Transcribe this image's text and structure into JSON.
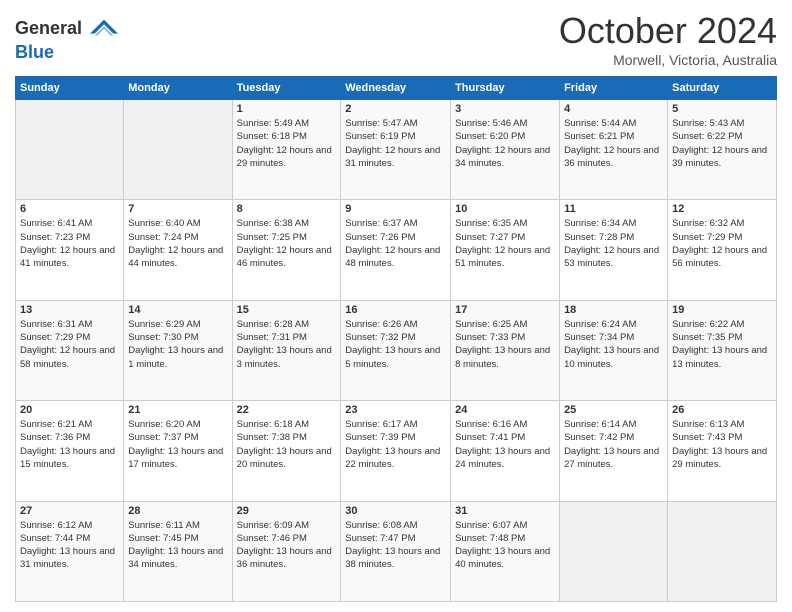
{
  "logo": {
    "line1": "General",
    "line2": "Blue"
  },
  "title": "October 2024",
  "location": "Morwell, Victoria, Australia",
  "days_of_week": [
    "Sunday",
    "Monday",
    "Tuesday",
    "Wednesday",
    "Thursday",
    "Friday",
    "Saturday"
  ],
  "weeks": [
    [
      {
        "day": "",
        "sunrise": "",
        "sunset": "",
        "daylight": ""
      },
      {
        "day": "",
        "sunrise": "",
        "sunset": "",
        "daylight": ""
      },
      {
        "day": "1",
        "sunrise": "Sunrise: 5:49 AM",
        "sunset": "Sunset: 6:18 PM",
        "daylight": "Daylight: 12 hours and 29 minutes."
      },
      {
        "day": "2",
        "sunrise": "Sunrise: 5:47 AM",
        "sunset": "Sunset: 6:19 PM",
        "daylight": "Daylight: 12 hours and 31 minutes."
      },
      {
        "day": "3",
        "sunrise": "Sunrise: 5:46 AM",
        "sunset": "Sunset: 6:20 PM",
        "daylight": "Daylight: 12 hours and 34 minutes."
      },
      {
        "day": "4",
        "sunrise": "Sunrise: 5:44 AM",
        "sunset": "Sunset: 6:21 PM",
        "daylight": "Daylight: 12 hours and 36 minutes."
      },
      {
        "day": "5",
        "sunrise": "Sunrise: 5:43 AM",
        "sunset": "Sunset: 6:22 PM",
        "daylight": "Daylight: 12 hours and 39 minutes."
      }
    ],
    [
      {
        "day": "6",
        "sunrise": "Sunrise: 6:41 AM",
        "sunset": "Sunset: 7:23 PM",
        "daylight": "Daylight: 12 hours and 41 minutes."
      },
      {
        "day": "7",
        "sunrise": "Sunrise: 6:40 AM",
        "sunset": "Sunset: 7:24 PM",
        "daylight": "Daylight: 12 hours and 44 minutes."
      },
      {
        "day": "8",
        "sunrise": "Sunrise: 6:38 AM",
        "sunset": "Sunset: 7:25 PM",
        "daylight": "Daylight: 12 hours and 46 minutes."
      },
      {
        "day": "9",
        "sunrise": "Sunrise: 6:37 AM",
        "sunset": "Sunset: 7:26 PM",
        "daylight": "Daylight: 12 hours and 48 minutes."
      },
      {
        "day": "10",
        "sunrise": "Sunrise: 6:35 AM",
        "sunset": "Sunset: 7:27 PM",
        "daylight": "Daylight: 12 hours and 51 minutes."
      },
      {
        "day": "11",
        "sunrise": "Sunrise: 6:34 AM",
        "sunset": "Sunset: 7:28 PM",
        "daylight": "Daylight: 12 hours and 53 minutes."
      },
      {
        "day": "12",
        "sunrise": "Sunrise: 6:32 AM",
        "sunset": "Sunset: 7:29 PM",
        "daylight": "Daylight: 12 hours and 56 minutes."
      }
    ],
    [
      {
        "day": "13",
        "sunrise": "Sunrise: 6:31 AM",
        "sunset": "Sunset: 7:29 PM",
        "daylight": "Daylight: 12 hours and 58 minutes."
      },
      {
        "day": "14",
        "sunrise": "Sunrise: 6:29 AM",
        "sunset": "Sunset: 7:30 PM",
        "daylight": "Daylight: 13 hours and 1 minute."
      },
      {
        "day": "15",
        "sunrise": "Sunrise: 6:28 AM",
        "sunset": "Sunset: 7:31 PM",
        "daylight": "Daylight: 13 hours and 3 minutes."
      },
      {
        "day": "16",
        "sunrise": "Sunrise: 6:26 AM",
        "sunset": "Sunset: 7:32 PM",
        "daylight": "Daylight: 13 hours and 5 minutes."
      },
      {
        "day": "17",
        "sunrise": "Sunrise: 6:25 AM",
        "sunset": "Sunset: 7:33 PM",
        "daylight": "Daylight: 13 hours and 8 minutes."
      },
      {
        "day": "18",
        "sunrise": "Sunrise: 6:24 AM",
        "sunset": "Sunset: 7:34 PM",
        "daylight": "Daylight: 13 hours and 10 minutes."
      },
      {
        "day": "19",
        "sunrise": "Sunrise: 6:22 AM",
        "sunset": "Sunset: 7:35 PM",
        "daylight": "Daylight: 13 hours and 13 minutes."
      }
    ],
    [
      {
        "day": "20",
        "sunrise": "Sunrise: 6:21 AM",
        "sunset": "Sunset: 7:36 PM",
        "daylight": "Daylight: 13 hours and 15 minutes."
      },
      {
        "day": "21",
        "sunrise": "Sunrise: 6:20 AM",
        "sunset": "Sunset: 7:37 PM",
        "daylight": "Daylight: 13 hours and 17 minutes."
      },
      {
        "day": "22",
        "sunrise": "Sunrise: 6:18 AM",
        "sunset": "Sunset: 7:38 PM",
        "daylight": "Daylight: 13 hours and 20 minutes."
      },
      {
        "day": "23",
        "sunrise": "Sunrise: 6:17 AM",
        "sunset": "Sunset: 7:39 PM",
        "daylight": "Daylight: 13 hours and 22 minutes."
      },
      {
        "day": "24",
        "sunrise": "Sunrise: 6:16 AM",
        "sunset": "Sunset: 7:41 PM",
        "daylight": "Daylight: 13 hours and 24 minutes."
      },
      {
        "day": "25",
        "sunrise": "Sunrise: 6:14 AM",
        "sunset": "Sunset: 7:42 PM",
        "daylight": "Daylight: 13 hours and 27 minutes."
      },
      {
        "day": "26",
        "sunrise": "Sunrise: 6:13 AM",
        "sunset": "Sunset: 7:43 PM",
        "daylight": "Daylight: 13 hours and 29 minutes."
      }
    ],
    [
      {
        "day": "27",
        "sunrise": "Sunrise: 6:12 AM",
        "sunset": "Sunset: 7:44 PM",
        "daylight": "Daylight: 13 hours and 31 minutes."
      },
      {
        "day": "28",
        "sunrise": "Sunrise: 6:11 AM",
        "sunset": "Sunset: 7:45 PM",
        "daylight": "Daylight: 13 hours and 34 minutes."
      },
      {
        "day": "29",
        "sunrise": "Sunrise: 6:09 AM",
        "sunset": "Sunset: 7:46 PM",
        "daylight": "Daylight: 13 hours and 36 minutes."
      },
      {
        "day": "30",
        "sunrise": "Sunrise: 6:08 AM",
        "sunset": "Sunset: 7:47 PM",
        "daylight": "Daylight: 13 hours and 38 minutes."
      },
      {
        "day": "31",
        "sunrise": "Sunrise: 6:07 AM",
        "sunset": "Sunset: 7:48 PM",
        "daylight": "Daylight: 13 hours and 40 minutes."
      },
      {
        "day": "",
        "sunrise": "",
        "sunset": "",
        "daylight": ""
      },
      {
        "day": "",
        "sunrise": "",
        "sunset": "",
        "daylight": ""
      }
    ]
  ]
}
